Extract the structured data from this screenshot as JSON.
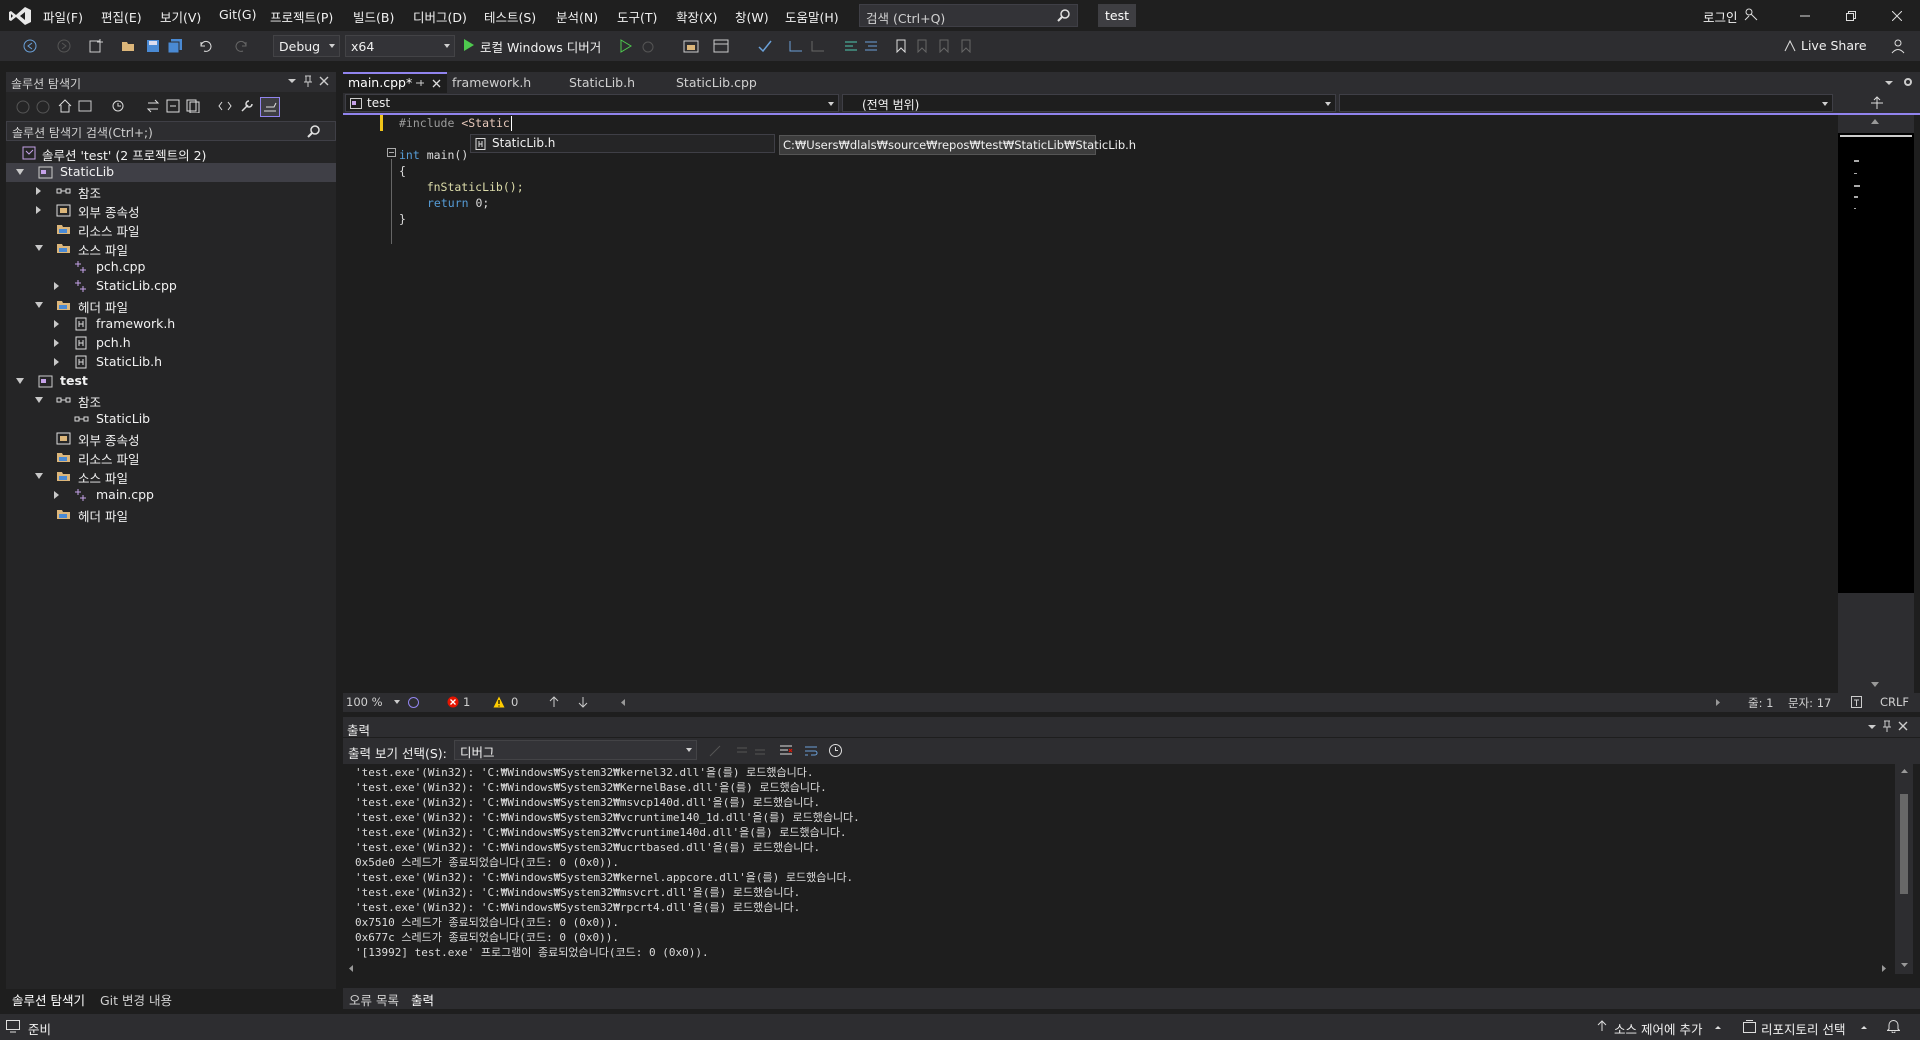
{
  "menu": {
    "items": [
      "파일(F)",
      "편집(E)",
      "보기(V)",
      "Git(G)",
      "프로젝트(P)",
      "빌드(B)",
      "디버그(D)",
      "테스트(S)",
      "분석(N)",
      "도구(T)",
      "확장(X)",
      "창(W)",
      "도움말(H)"
    ],
    "search_placeholder": "검색 (Ctrl+Q)",
    "solution_name": "test",
    "login": "로그인"
  },
  "toolbar": {
    "config": "Debug",
    "platform": "x64",
    "run_label": "로컬 Windows 디버거",
    "live_share": "Live Share"
  },
  "solution_explorer": {
    "title": "솔루션 탐색기",
    "search_placeholder": "솔루션 탐색기 검색(Ctrl+;)",
    "tree": [
      {
        "label": "솔루션 'test'  (2 프로젝트의 2)",
        "icon": "solution-icon"
      },
      {
        "label": "StaticLib",
        "icon": "project-icon"
      },
      {
        "label": "참조",
        "icon": "references-icon"
      },
      {
        "label": "외부 종속성",
        "icon": "external-deps-icon"
      },
      {
        "label": "리소스 파일",
        "icon": "folder-icon"
      },
      {
        "label": "소스 파일",
        "icon": "folder-icon"
      },
      {
        "label": "pch.cpp",
        "icon": "cpp-file-icon"
      },
      {
        "label": "StaticLib.cpp",
        "icon": "cpp-file-icon"
      },
      {
        "label": "헤더 파일",
        "icon": "folder-icon"
      },
      {
        "label": "framework.h",
        "icon": "header-file-icon"
      },
      {
        "label": "pch.h",
        "icon": "header-file-icon"
      },
      {
        "label": "StaticLib.h",
        "icon": "header-file-icon"
      },
      {
        "label": "test",
        "icon": "project-icon"
      },
      {
        "label": "참조",
        "icon": "references-icon"
      },
      {
        "label": "StaticLib",
        "icon": "references-icon"
      },
      {
        "label": "외부 종속성",
        "icon": "external-deps-icon"
      },
      {
        "label": "리소스 파일",
        "icon": "folder-icon"
      },
      {
        "label": "소스 파일",
        "icon": "folder-icon"
      },
      {
        "label": "main.cpp",
        "icon": "cpp-file-icon"
      },
      {
        "label": "헤더 파일",
        "icon": "folder-icon"
      }
    ],
    "bottom_tabs": [
      "솔루션 탐색기",
      "Git 변경 내용"
    ]
  },
  "editor": {
    "tabs": [
      "main.cpp*",
      "framework.h",
      "StaticLib.h",
      "StaticLib.cpp"
    ],
    "nav_project": "test",
    "nav_scope": "(전역 범위)",
    "code": {
      "l1_directive": "#include",
      "l1_path": "<Static",
      "l2_kw": "int",
      "l2_rest": " main()",
      "l3": "{",
      "l4": "    fnStaticLib();",
      "l5_kw": "return",
      "l5_rest": " 0;",
      "l6": "}"
    },
    "completion_item": "StaticLib.h",
    "completion_tooltip": "C:₩Users₩dlals₩source₩repos₩test₩StaticLib₩StaticLib.h",
    "status": {
      "zoom": "100 %",
      "errors": "1",
      "warnings": "0",
      "line": "줄: 1",
      "col": "문자: 17",
      "eol": "CRLF"
    }
  },
  "output": {
    "title": "출력",
    "show_from_label": "출력 보기 선택(S):",
    "source": "디버그",
    "lines": [
      "'test.exe'(Win32): 'C:₩Windows₩System32₩kernel32.dll'을(를) 로드했습니다.",
      "'test.exe'(Win32): 'C:₩Windows₩System32₩KernelBase.dll'을(를) 로드했습니다.",
      "'test.exe'(Win32): 'C:₩Windows₩System32₩msvcp140d.dll'을(를) 로드했습니다.",
      "'test.exe'(Win32): 'C:₩Windows₩System32₩vcruntime140_1d.dll'을(를) 로드했습니다.",
      "'test.exe'(Win32): 'C:₩Windows₩System32₩vcruntime140d.dll'을(를) 로드했습니다.",
      "'test.exe'(Win32): 'C:₩Windows₩System32₩ucrtbased.dll'을(를) 로드했습니다.",
      "0x5de0 스레드가 종료되었습니다(코드: 0 (0x0)).",
      "'test.exe'(Win32): 'C:₩Windows₩System32₩kernel.appcore.dll'을(를) 로드했습니다.",
      "'test.exe'(Win32): 'C:₩Windows₩System32₩msvcrt.dll'을(를) 로드했습니다.",
      "'test.exe'(Win32): 'C:₩Windows₩System32₩rpcrt4.dll'을(를) 로드했습니다.",
      "0x7510 스레드가 종료되었습니다(코드: 0 (0x0)).",
      "0x677c 스레드가 종료되었습니다(코드: 0 (0x0)).",
      "'[13992] test.exe' 프로그램이 종료되었습니다(코드: 0 (0x0))."
    ],
    "bottom_tabs": [
      "오류 목록",
      "출력"
    ]
  },
  "statusbar": {
    "ready": "준비",
    "source_control": "소스 제어에 추가",
    "repo": "리포지토리 선택"
  },
  "colors": {
    "accent": "#9184ee",
    "run_green": "#4ec94e",
    "error_red": "#e51400",
    "warning_yellow": "#ffcc00"
  }
}
